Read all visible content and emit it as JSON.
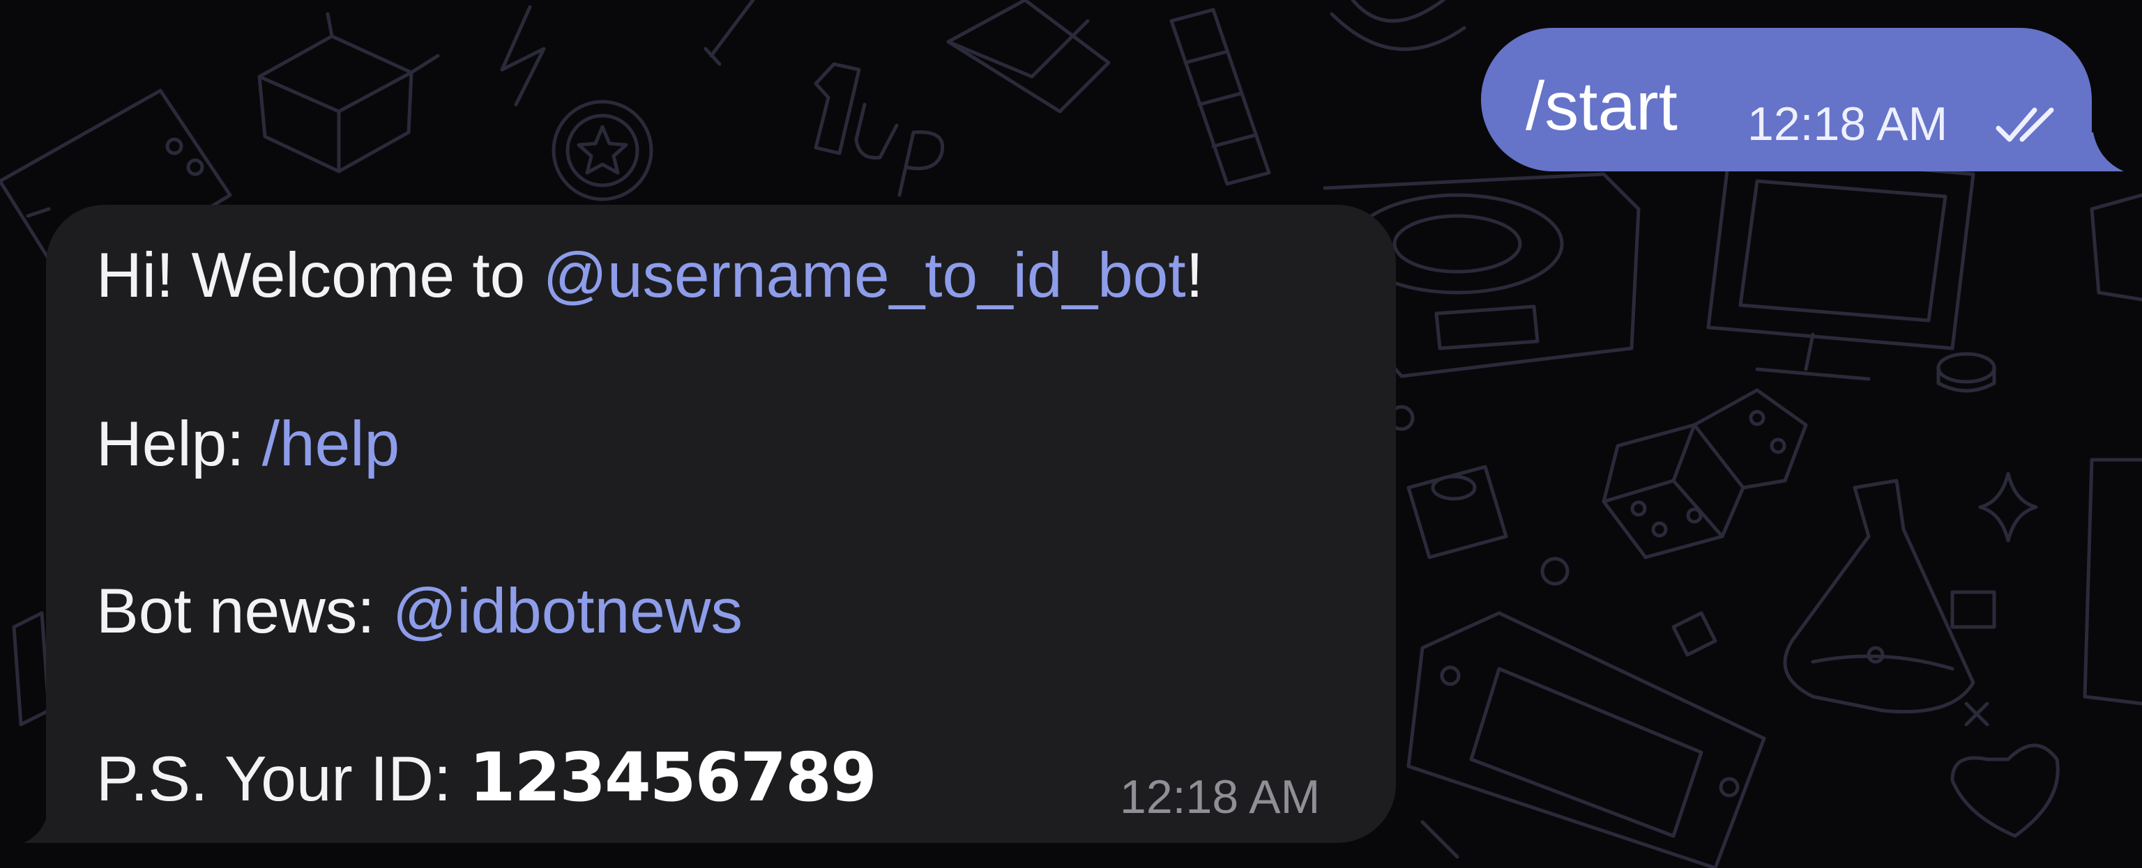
{
  "colors": {
    "background": "#08080a",
    "pattern_stroke": "#2a2a3a",
    "outgoing_bubble": "#6573c8",
    "incoming_bubble": "#1d1d20",
    "link": "#8e9dea",
    "text": "#f3f3f5",
    "muted_time": "#8f8f96"
  },
  "outgoing_message": {
    "text": "/start",
    "time": "12:18 AM",
    "status_icon": "double-check-icon"
  },
  "incoming_message": {
    "line1": {
      "prefix": "Hi! Welcome to ",
      "link": "@username_to_id_bot",
      "suffix": "!"
    },
    "line2": {
      "prefix": "Help: ",
      "link": "/help"
    },
    "line3": {
      "prefix": "Bot news: ",
      "link": "@idbotnews"
    },
    "line4": {
      "prefix": "P.S. Your ID: ",
      "id_value": "123456789"
    },
    "time": "12:18 AM"
  },
  "background_icons": [
    "box-icon",
    "lightning-icon",
    "coin-icon",
    "one-up-icon",
    "envelope-icon",
    "game-console-icon",
    "monitor-icon",
    "dice-icon",
    "potion-flask-icon",
    "handheld-console-icon",
    "heart-icon",
    "sparkle-icon"
  ]
}
